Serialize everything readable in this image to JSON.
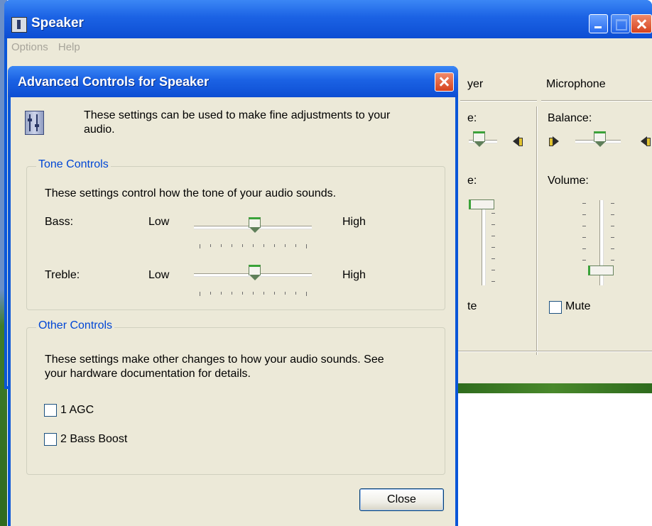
{
  "background_window": {
    "title": "Speaker",
    "menu": [
      "Options",
      "Help"
    ],
    "columns": {
      "player": {
        "header": "yer",
        "balance_label": "e:",
        "volume_label": "e:",
        "mute_label": "te"
      },
      "microphone": {
        "header": "Microphone",
        "balance_label": "Balance:",
        "volume_label": "Volume:",
        "mute_label": "Mute"
      }
    }
  },
  "dialog": {
    "title": "Advanced Controls for Speaker",
    "description_line1": "These settings can be used to make fine adjustments to your",
    "description_line2": "audio.",
    "tone_controls": {
      "label": "Tone Controls",
      "description": "These settings control how the tone of your audio sounds.",
      "bass": {
        "label": "Bass:",
        "low": "Low",
        "high": "High",
        "level": 0.5
      },
      "treble": {
        "label": "Treble:",
        "low": "Low",
        "high": "High",
        "level": 0.5
      }
    },
    "other_controls": {
      "label": "Other Controls",
      "description_line1": "These settings make other changes to how your audio sounds.  See",
      "description_line2": "your hardware documentation for details.",
      "options": [
        {
          "label": "1  AGC",
          "checked": false
        },
        {
          "label": "2  Bass Boost",
          "checked": false
        }
      ]
    },
    "close_button": "Close"
  }
}
